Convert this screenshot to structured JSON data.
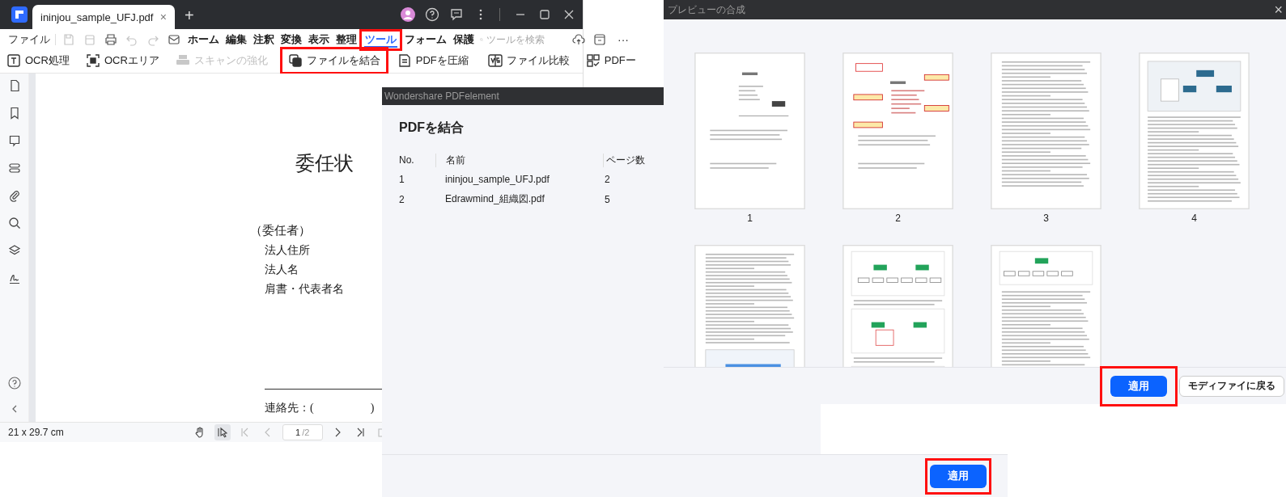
{
  "app": {
    "tab": {
      "title": "ininjou_sample_UFJ.pdf",
      "close": "×"
    },
    "new_tab": "+",
    "menu": {
      "file": "ファイル",
      "items": [
        {
          "label": "ホーム",
          "selected": false,
          "highlighted": false
        },
        {
          "label": "編集",
          "selected": false,
          "highlighted": false
        },
        {
          "label": "注釈",
          "selected": false,
          "highlighted": false
        },
        {
          "label": "変換",
          "selected": false,
          "highlighted": false
        },
        {
          "label": "表示",
          "selected": false,
          "highlighted": false
        },
        {
          "label": "整理",
          "selected": false,
          "highlighted": false
        },
        {
          "label": "ツール",
          "selected": true,
          "highlighted": true
        },
        {
          "label": "フォーム",
          "selected": false,
          "highlighted": false
        },
        {
          "label": "保護",
          "selected": false,
          "highlighted": false
        }
      ],
      "search": {
        "placeholder": "ツールを検索"
      },
      "more": "···"
    },
    "toolbar": [
      {
        "kind": "ocr",
        "label": "OCR処理",
        "disabled": false,
        "highlighted": false
      },
      {
        "kind": "ocr-area",
        "label": "OCRエリア",
        "disabled": false,
        "highlighted": false
      },
      {
        "kind": "scan",
        "label": "スキャンの強化",
        "disabled": true,
        "highlighted": false
      },
      {
        "kind": "merge",
        "label": "ファイルを結合",
        "disabled": false,
        "highlighted": true
      },
      {
        "kind": "compress",
        "label": "PDFを圧縮",
        "disabled": false,
        "highlighted": false
      },
      {
        "kind": "compare",
        "label": "ファイル比較",
        "disabled": false,
        "highlighted": false
      },
      {
        "kind": "convert",
        "label": "PDFー",
        "disabled": false,
        "highlighted": false
      }
    ],
    "document": {
      "title": "委任状",
      "principal": "（委任者）",
      "lines": [
        "法人住所",
        "法人名",
        "肩書・代表者名"
      ],
      "contact": "連絡先：(　　　　　)"
    },
    "status_bar": {
      "size": "21 x 29.7 cm",
      "page": "1",
      "page_total": "/2"
    }
  },
  "merge_dialog": {
    "window_title": "Wondershare PDFelement",
    "heading": "PDFを結合",
    "columns": [
      "No.",
      "名前",
      "ページ数"
    ],
    "rows": [
      [
        "1",
        "ininjou_sample_UFJ.pdf",
        "2"
      ],
      [
        "2",
        "Edrawmind_組織図.pdf",
        "5"
      ]
    ],
    "apply": {
      "label": "適用",
      "highlighted": true
    }
  },
  "preview": {
    "window_title": "プレビューの合成",
    "close": "×",
    "thumbnails": [
      {
        "kind": "form",
        "label": "1"
      },
      {
        "kind": "form-annotated",
        "label": "2"
      },
      {
        "kind": "text",
        "label": "3"
      },
      {
        "kind": "screenshot",
        "label": "4"
      },
      {
        "kind": "text-figure"
      },
      {
        "kind": "diagram"
      },
      {
        "kind": "diagram-text"
      }
    ],
    "apply": {
      "label": "適用",
      "highlighted": true
    },
    "back": "モディファイに戻る"
  }
}
